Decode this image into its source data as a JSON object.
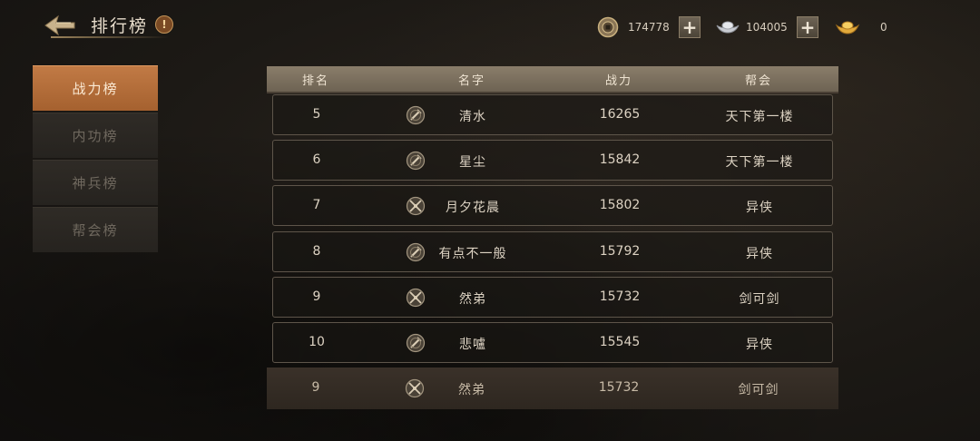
{
  "header": {
    "title": "排行榜",
    "help_label": "!"
  },
  "currencies": [
    {
      "icon": "coin-icon",
      "value": "174778"
    },
    {
      "icon": "silver-ingot-icon",
      "value": "104005"
    },
    {
      "icon": "gold-ingot-icon",
      "value": "0"
    }
  ],
  "plus_label": "+",
  "sidebar": {
    "tabs": [
      {
        "label": "战力榜",
        "active": true
      },
      {
        "label": "内功榜",
        "active": false
      },
      {
        "label": "神兵榜",
        "active": false
      },
      {
        "label": "帮会榜",
        "active": false
      }
    ]
  },
  "table": {
    "headers": {
      "rank": "排名",
      "name": "名字",
      "power": "战力",
      "guild": "帮会"
    },
    "rows": [
      {
        "rank": "5",
        "name": "清水",
        "power": "16265",
        "guild": "天下第一楼",
        "class_icon": "sword-emblem-icon"
      },
      {
        "rank": "6",
        "name": "星尘",
        "power": "15842",
        "guild": "天下第一楼",
        "class_icon": "sword-emblem-icon"
      },
      {
        "rank": "7",
        "name": "月夕花晨",
        "power": "15802",
        "guild": "异侠",
        "class_icon": "crossed-blades-emblem-icon"
      },
      {
        "rank": "8",
        "name": "有点不一般",
        "power": "15792",
        "guild": "异侠",
        "class_icon": "sword-emblem-icon"
      },
      {
        "rank": "9",
        "name": "然弟",
        "power": "15732",
        "guild": "剑可剑",
        "class_icon": "crossed-blades-emblem-icon"
      },
      {
        "rank": "10",
        "name": "悲嚧",
        "power": "15545",
        "guild": "异侠",
        "class_icon": "sword-emblem-icon"
      }
    ],
    "my_row": {
      "rank": "9",
      "name": "然弟",
      "power": "15732",
      "guild": "剑可剑",
      "class_icon": "crossed-blades-emblem-icon"
    }
  }
}
